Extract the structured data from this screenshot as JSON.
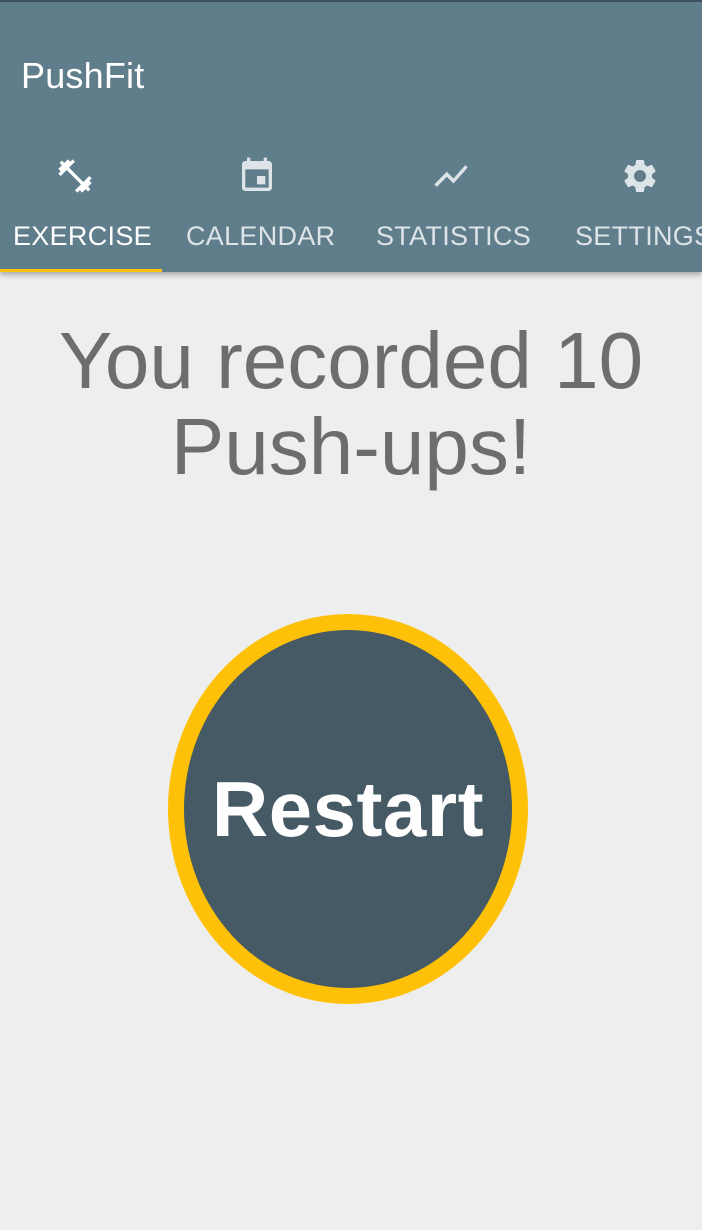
{
  "app": {
    "title": "PushFit"
  },
  "tabs": [
    {
      "label": "EXERCISE",
      "icon": "dumbbell-icon",
      "active": true
    },
    {
      "label": "CALENDAR",
      "icon": "calendar-icon",
      "active": false
    },
    {
      "label": "STATISTICS",
      "icon": "trending-icon",
      "active": false
    },
    {
      "label": "SETTINGS",
      "icon": "gear-icon",
      "active": false
    }
  ],
  "main": {
    "message": "You recorded 10 Push-ups!",
    "restart_label": "Restart"
  },
  "colors": {
    "app_bar": "#607d8b",
    "accent": "#ffc107",
    "button": "#455a64",
    "background": "#eeeeee",
    "message_text": "#6d6d6d"
  }
}
